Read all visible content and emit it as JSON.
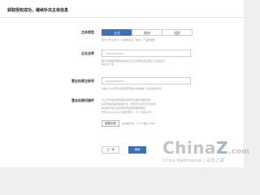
{
  "header": {
    "title": "获取授权成功，继续补充主体信息"
  },
  "subject_type": {
    "label": "主体类型",
    "options": [
      "企业",
      "政府",
      "组织"
    ],
    "selected": "企业",
    "hint": "如为个体工商户，请选择企业，组织：产品规格数"
  },
  "company_name": {
    "label": "企业全称",
    "value": "",
    "hint_lines": [
      "需与当地政府颁发的商业许可证书或企业注册证上的企业名",
      "称完全一致"
    ]
  },
  "license_number": {
    "label": "营业执照注册号",
    "value": "",
    "hint": "请输入15位营业执照注册号或18位的统一社会信用代码"
  },
  "license_scan": {
    "label": "营业执照扫描件",
    "hint_lines": [
      "请上传营业执照清晰彩色原件扫描件或数码照",
      "在有效期内且年检章齐全（当年成立的可无年检章）",
      "由中国大陆工商局或市场监督管理局颁发",
      "支持 jpg jpeg bmp格式照片，大小不超过5M"
    ],
    "choose_button": "选择文件",
    "file_status": "未选择文件，大小不超过 5MB"
  },
  "actions": {
    "prev_label": "上一步",
    "next_label": "继续"
  },
  "watermark": {
    "logo_prefix": "China",
    "logo_z": "Z",
    "logo_suffix": ".com",
    "subtitle": "China Webmaster | 站长之家"
  },
  "colors": {
    "accent": "#3d6fb6",
    "background": "#efefef",
    "panel": "#ffffff"
  }
}
